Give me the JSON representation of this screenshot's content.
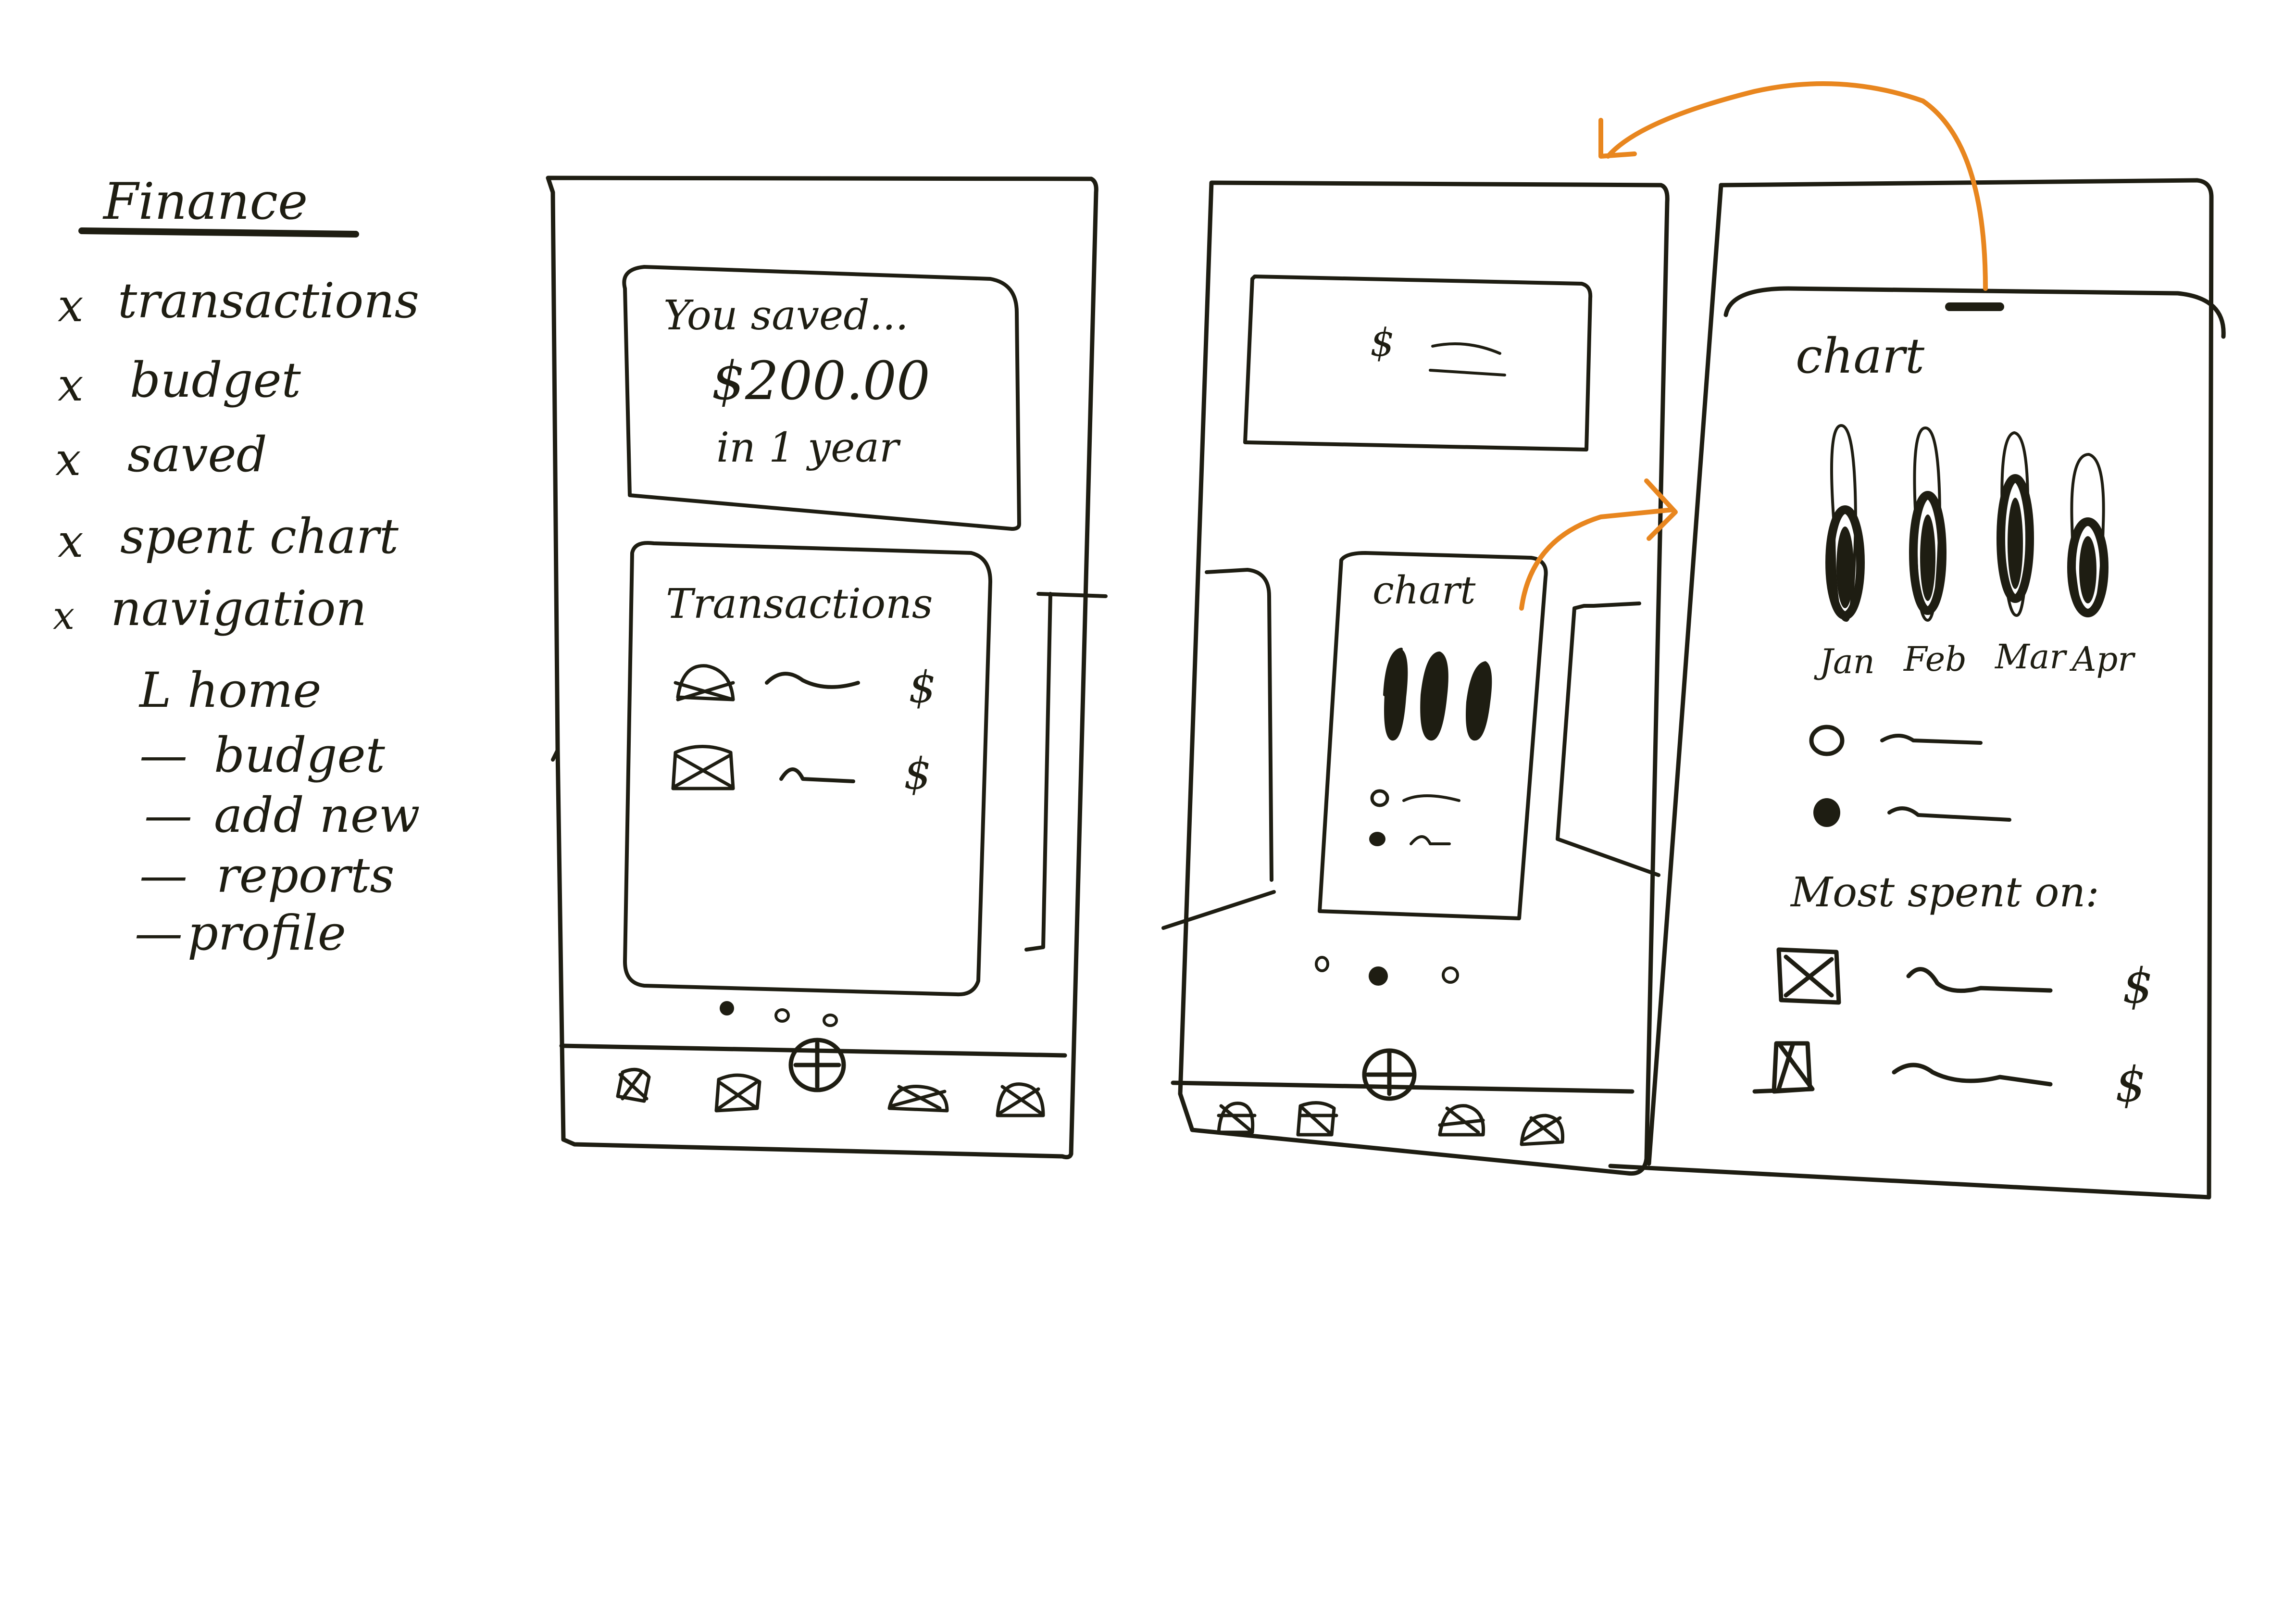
{
  "notes": {
    "title": "Finance",
    "items": [
      {
        "bullet": "x",
        "label": "transactions"
      },
      {
        "bullet": "x",
        "label": "budget"
      },
      {
        "bullet": "x",
        "label": "saved"
      },
      {
        "bullet": "x",
        "label": "spent chart"
      },
      {
        "bullet": "x",
        "label": "navigation"
      }
    ],
    "sub_items": [
      {
        "bullet": "L",
        "label": "home"
      },
      {
        "bullet": "—",
        "label": "budget"
      },
      {
        "bullet": "—",
        "label": "add new"
      },
      {
        "bullet": "—",
        "label": "reports"
      },
      {
        "bullet": "—",
        "label": "profile"
      }
    ]
  },
  "screen1": {
    "saved_intro": "You saved...",
    "saved_amount": "$200.00",
    "saved_period": "in 1 year",
    "transactions_title": "Transactions",
    "rows": [
      {
        "currency": "$"
      },
      {
        "currency": "$"
      }
    ],
    "nav_icons": [
      "home-icon",
      "budget-icon",
      "add-new-icon",
      "reports-icon",
      "profile-icon"
    ]
  },
  "screen2": {
    "summary_currency": "$",
    "chart_title": "chart",
    "nav_icons": [
      "home-icon",
      "budget-icon",
      "add-new-icon",
      "reports-icon",
      "profile-icon"
    ]
  },
  "screen3": {
    "chart_title": "chart",
    "months": [
      "Jan",
      "Feb",
      "Mar",
      "Apr"
    ],
    "most_spent_title": "Most spent on:",
    "rows": [
      {
        "currency": "$"
      },
      {
        "currency": "$"
      }
    ]
  },
  "colors": {
    "ink": "#1e1d12",
    "accent": "#e8861f",
    "paper": "#ffffff"
  }
}
